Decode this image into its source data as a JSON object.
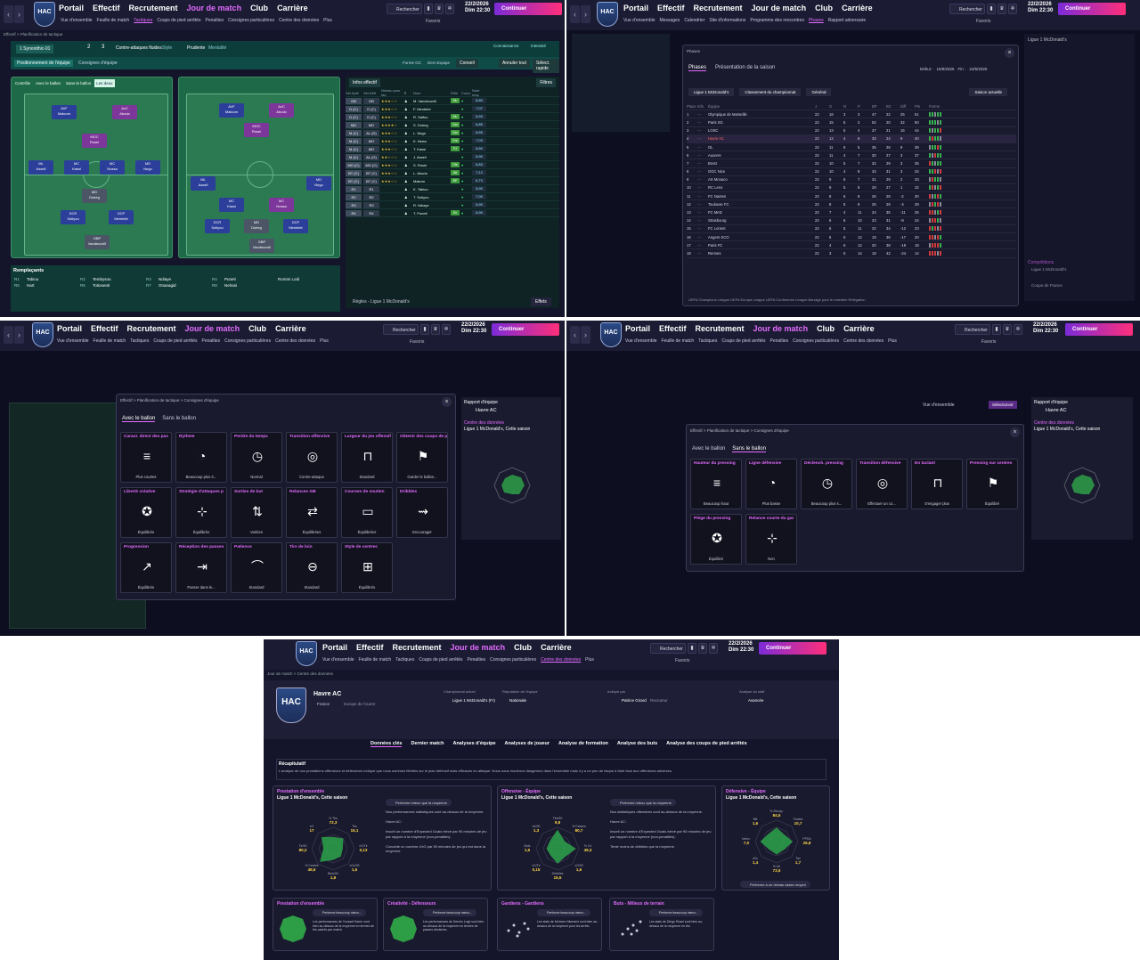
{
  "nav": {
    "portail": "Portail",
    "effectif": "Effectif",
    "recrutement": "Recrutement",
    "jour_de_match": "Jour de match",
    "club": "Club",
    "carriere": "Carrière",
    "search": "Rechercher",
    "date": "22/2/2026",
    "day_time": "Dim 22:30",
    "continuer": "Continuer",
    "favoris": "Favoris",
    "plus": "Plus"
  },
  "club": {
    "logo_text": "HAC"
  },
  "sub_jdm": [
    "Vue d'ensemble",
    "Feuille de match",
    "Tactiques",
    "Coups de pied arrêtés",
    "Penalties",
    "Consignes particulières",
    "Centre des données"
  ],
  "sub_jdm_short": [
    "Vue d'ensemble",
    "Messages",
    "Calendrier",
    "Site d'informations",
    "Programme des rencontres",
    "Phases",
    "Rapport adversaire"
  ],
  "breadcrumb_tactics": "Effectif  >  Planification de tactique",
  "tactics": {
    "slot": "1  Synonithic-01",
    "slots": [
      "2",
      "3"
    ],
    "style": "Contre-attaques fluides",
    "style_tag": "Style",
    "mentalite": "Prudente",
    "mentalite_tag": "Mentalité",
    "familiarity": "Connaissance",
    "intensity": "Intensité",
    "tab1": "Positionnement de l'équipe",
    "tab2": "Consignes d'équipe",
    "form": "Forme GC",
    "xg": "Dern.Equipe",
    "conseil": "Conseil",
    "annuler": "Annuler tout",
    "select_rapide": "Sélect. rapide",
    "phases": [
      "Contrôle",
      "Avec le ballon",
      "Sans le ballon",
      "Les deux"
    ],
    "infos": "Infos effectif",
    "filtres": "Filtres",
    "col_headers": [
      "Sél.Actif",
      "Sél.Défi",
      "Niveau pour tac.",
      "Ⅱ",
      "Nom",
      "Rôle",
      "Cond.",
      "Note moy."
    ],
    "rows": [
      {
        "pos": "GB",
        "role": "GB",
        "stars": "★★★☆☆",
        "name": "M. Vandecovill",
        "tag": "Mu",
        "val": "6,80"
      },
      {
        "pos": "D (C)",
        "role": "D (C)",
        "stars": "★★★☆☆",
        "name": "F. Mentelet",
        "tag": "",
        "val": "7,07"
      },
      {
        "pos": "D (C)",
        "role": "D (C)",
        "stars": "★★★☆☆",
        "name": "R. Saifou",
        "tag": "Mu",
        "val": "6,93"
      },
      {
        "pos": "MD",
        "role": "MD",
        "stars": "★★★★☆",
        "name": "S. Doireg",
        "tag": "Gar",
        "val": "6,85"
      },
      {
        "pos": "M (C)",
        "role": "AL (D)",
        "stars": "★★★☆☆",
        "name": "L. Nego",
        "tag": "Gar",
        "val": "6,55"
      },
      {
        "pos": "M (C)",
        "role": "MO",
        "stars": "★★★☆☆",
        "name": "K. Newo",
        "tag": "Ent",
        "val": "7,03"
      },
      {
        "pos": "M (C)",
        "role": "MO",
        "stars": "★★★☆☆",
        "name": "T. Kassi",
        "tag": "PJ",
        "val": "6,50"
      },
      {
        "pos": "M (C)",
        "role": "AL (G)",
        "stars": "★★☆☆☆",
        "name": "J. Assell",
        "tag": "",
        "val": "6,90"
      },
      {
        "pos": "MO (C)",
        "role": "MO (C)",
        "stars": "★★★☆☆",
        "name": "S. Rosel",
        "tag": "Ofe",
        "val": "6,83"
      },
      {
        "pos": "BT (C)",
        "role": "BT (C)",
        "stars": "★★★☆☆",
        "name": "L. Abodo",
        "tag": "Att",
        "val": "7,12"
      },
      {
        "pos": "BT (C)",
        "role": "BT (C)",
        "stars": "★★★☆☆",
        "name": "Makom",
        "tag": "BP",
        "val": "6,73"
      },
      {
        "pos": "R1",
        "role": "R1",
        "stars": "",
        "name": "K. Tabiou",
        "tag": "",
        "val": "6,90"
      },
      {
        "pos": "R2",
        "role": "R2",
        "stars": "",
        "name": "T. Sotiyou",
        "tag": "",
        "val": "7,00"
      },
      {
        "pos": "R3",
        "role": "R3",
        "stars": "",
        "name": "R. Ndiaye",
        "tag": "",
        "val": "6,90"
      },
      {
        "pos": "R4",
        "role": "R4",
        "stars": "",
        "name": "T. Puneti",
        "tag": "Ex",
        "val": "6,90"
      }
    ],
    "rules": "Règles - Ligue 1 McDonald's",
    "next": "Effets",
    "remplacants": "Remplaçants",
    "bench": [
      {
        "pos": "R1",
        "name": "Tabiou",
        "pos2": "R2",
        "name2": "Tembysou",
        "pos3": "R3",
        "name3": "Ndiaye",
        "pos4": "R4",
        "name4": "Puneti",
        "name5": "Rommi Lodi"
      },
      {
        "pos": "R5",
        "name": "Hart",
        "pos2": "R6",
        "name2": "Totionenti",
        "pos3": "R7",
        "name3": "Onanagid",
        "pos4": "R8",
        "name4": "Nehasi",
        "name5": ""
      }
    ],
    "players_left": [
      {
        "name": "Matcom",
        "role": "AVF"
      },
      {
        "name": "Abodo",
        "role": "AvC"
      },
      {
        "name": "Rosel",
        "role": "MOC"
      },
      {
        "name": "Assell",
        "role": "ML"
      },
      {
        "name": "Kassi",
        "role": "MC"
      },
      {
        "name": "Nossa",
        "role": "MC"
      },
      {
        "name": "Nego",
        "role": "MD"
      },
      {
        "name": "Doireg",
        "role": "MD"
      },
      {
        "name": "Sotiyou",
        "role": "DCR"
      },
      {
        "name": "Mentelet",
        "role": "DCP"
      },
      {
        "name": "Vandecovill",
        "role": "GBP"
      }
    ]
  },
  "league": {
    "title": "Phases",
    "tab1": "Phases",
    "tab2": "Présentation de la saison",
    "debut": "Début :",
    "debut_val": "15/8/2025",
    "fin": "Fin :",
    "fin_val": "24/5/2026",
    "filter1": "Ligue 1 McDonald's",
    "filter2": "Classement du championnat",
    "filter3": "Général",
    "saison": "Saison actuelle",
    "headers": [
      "Place",
      "Info",
      "Équipe",
      "J",
      "G",
      "N",
      "P",
      "BP",
      "BC",
      "Diff",
      "Pts",
      "Forme"
    ],
    "rows": [
      {
        "p": "1",
        "t": "Olympique de Marseille",
        "j": "22",
        "g": "16",
        "n": "3",
        "d": "3",
        "bp": "47",
        "bc": "22",
        "diff": "25",
        "pts": "51"
      },
      {
        "p": "2",
        "t": "Paris SG",
        "j": "22",
        "g": "15",
        "n": "5",
        "d": "2",
        "bp": "52",
        "bc": "20",
        "diff": "32",
        "pts": "50"
      },
      {
        "p": "3",
        "t": "LOSC",
        "j": "22",
        "g": "13",
        "n": "5",
        "d": "4",
        "bp": "37",
        "bc": "21",
        "diff": "16",
        "pts": "44"
      },
      {
        "p": "4",
        "t": "Havre AC",
        "j": "22",
        "g": "12",
        "n": "4",
        "d": "6",
        "bp": "33",
        "bc": "24",
        "diff": "9",
        "pts": "40"
      },
      {
        "p": "5",
        "t": "OL",
        "j": "22",
        "g": "11",
        "n": "6",
        "d": "5",
        "bp": "35",
        "bc": "26",
        "diff": "9",
        "pts": "39"
      },
      {
        "p": "6",
        "t": "Auxerre",
        "j": "22",
        "g": "11",
        "n": "4",
        "d": "7",
        "bp": "30",
        "bc": "27",
        "diff": "3",
        "pts": "37"
      },
      {
        "p": "7",
        "t": "Brest",
        "j": "22",
        "g": "10",
        "n": "5",
        "d": "7",
        "bp": "32",
        "bc": "29",
        "diff": "3",
        "pts": "35"
      },
      {
        "p": "8",
        "t": "OGC Nice",
        "j": "22",
        "g": "10",
        "n": "4",
        "d": "8",
        "bp": "34",
        "bc": "31",
        "diff": "3",
        "pts": "34"
      },
      {
        "p": "9",
        "t": "AS Monaco",
        "j": "22",
        "g": "9",
        "n": "6",
        "d": "7",
        "bp": "31",
        "bc": "29",
        "diff": "2",
        "pts": "33"
      },
      {
        "p": "10",
        "t": "RC Lens",
        "j": "22",
        "g": "9",
        "n": "5",
        "d": "8",
        "bp": "28",
        "bc": "27",
        "diff": "1",
        "pts": "32"
      },
      {
        "p": "11",
        "t": "FC Nantes",
        "j": "22",
        "g": "8",
        "n": "6",
        "d": "8",
        "bp": "26",
        "bc": "28",
        "diff": "-2",
        "pts": "30"
      },
      {
        "p": "12",
        "t": "Toulouse FC",
        "j": "22",
        "g": "8",
        "n": "5",
        "d": "9",
        "bp": "25",
        "bc": "29",
        "diff": "-4",
        "pts": "29"
      },
      {
        "p": "13",
        "t": "FC Metz",
        "j": "22",
        "g": "7",
        "n": "4",
        "d": "11",
        "bp": "24",
        "bc": "35",
        "diff": "-11",
        "pts": "25"
      },
      {
        "p": "14",
        "t": "Strasbourg",
        "j": "22",
        "g": "6",
        "n": "6",
        "d": "10",
        "bp": "23",
        "bc": "31",
        "diff": "-8",
        "pts": "24"
      },
      {
        "p": "15",
        "t": "FC Lorient",
        "j": "22",
        "g": "6",
        "n": "5",
        "d": "11",
        "bp": "22",
        "bc": "34",
        "diff": "-12",
        "pts": "23"
      },
      {
        "p": "16",
        "t": "Angers SCO",
        "j": "22",
        "g": "5",
        "n": "5",
        "d": "12",
        "bp": "19",
        "bc": "36",
        "diff": "-17",
        "pts": "20"
      },
      {
        "p": "17",
        "t": "Paris FC",
        "j": "22",
        "g": "4",
        "n": "6",
        "d": "12",
        "bp": "20",
        "bc": "38",
        "diff": "-18",
        "pts": "18"
      },
      {
        "p": "18",
        "t": "Rennes",
        "j": "22",
        "g": "3",
        "n": "5",
        "d": "14",
        "bp": "18",
        "bc": "42",
        "diff": "-24",
        "pts": "14"
      }
    ],
    "legend": "UEFA Champions League    UEFA Europa League    UEFA Conference League    Barrage pour le maintien    Relégation",
    "side_title": "Ligue 1 McDonald's",
    "side_comp": "Compétitions",
    "side_comp1": "Ligue 1 McDonald's",
    "side_comp2": "Coupe de France"
  },
  "with_ball": {
    "tab_a": "Avec le ballon",
    "tab_b": "Sans le ballon",
    "cards": [
      {
        "t": "Caract. direct des pas",
        "v": "Plus courtes"
      },
      {
        "t": "Rythme",
        "v": "Beaucoup plus é..."
      },
      {
        "t": "Perdre du temps",
        "v": "Normal"
      },
      {
        "t": "Transition offensive",
        "v": "Contre-attaque"
      },
      {
        "t": "Largeur du jeu offensif",
        "v": "Standard"
      },
      {
        "t": "Obtenir des coups de p",
        "v": "Garder le ballon..."
      },
      {
        "t": "Liberté créative",
        "v": "Équilibrée"
      },
      {
        "t": "Stratégie d'attaques p",
        "v": "Équilibrée"
      },
      {
        "t": "Sorties de but",
        "v": "Variées"
      },
      {
        "t": "Relances GB",
        "v": "Équilibrées"
      },
      {
        "t": "Courses de soutien",
        "v": "Équilibrées"
      },
      {
        "t": "Dribbles",
        "v": "Encourager"
      },
      {
        "t": "Progression",
        "v": "Équilibrée"
      },
      {
        "t": "Réception des passes",
        "v": "Passer dans le..."
      },
      {
        "t": "Patience",
        "v": "Standard"
      },
      {
        "t": "Tirs de loin",
        "v": "Standard"
      },
      {
        "t": "Style de centres",
        "v": "Équilibrés"
      }
    ],
    "side_rapport": "Rapport d'équipe",
    "side_team": "Havre AC",
    "side_data": "Centre des données",
    "side_league": "Ligue 1 McDonald's, Cette saison",
    "breadcrumb": "Effectif > Planification de tactique > Consignes d'équipe"
  },
  "without_ball": {
    "tab_a": "Avec le ballon",
    "tab_b": "Sans le ballon",
    "cards": [
      {
        "t": "Hauteur du pressing",
        "v": "Beaucoup haut"
      },
      {
        "t": "Ligne défensive",
        "v": "Plus basse"
      },
      {
        "t": "Déclench. pressing",
        "v": "Beaucoup plus s..."
      },
      {
        "t": "Transition défensive",
        "v": "Effectuer un co..."
      },
      {
        "t": "En taclant",
        "v": "S'engager plus"
      },
      {
        "t": "Pressing sur centres",
        "v": "Équilibré"
      },
      {
        "t": "Piège du pressing",
        "v": "Équilibré"
      },
      {
        "t": "Relance courte du gar",
        "v": "Non"
      }
    ],
    "overview": "Vue d'ensemble",
    "selection": "Sélectionné"
  },
  "data_centre": {
    "breadcrumb": "Jour de match  >  Centre des données",
    "team": "Havre AC",
    "country": "France",
    "region": "Europe de l'ouest",
    "champ_label": "Championnat actuel",
    "champ": "Ligue 1 McDonald's (Fr)",
    "rep_label": "Réputation de l'équipe",
    "rep": "Nationale",
    "analyst_label": "Indiqué par",
    "analyst": "Patrice Girard",
    "analyst_role": "Recruteur",
    "data_label": "Analyse du staff",
    "data_val": "Avancée",
    "tabs": [
      "Données clés",
      "Dernier match",
      "Analyses d'équipe",
      "Analyses de joueur",
      "Analyse de formation",
      "Analyse des buts",
      "Analyse des coups de pied arrêtés"
    ],
    "recap_title": "Récapitulatif",
    "recap_text": "L'analyse de nos prestations offensives et défensives indique que nous sommes fébriles sur le plan défensif mais efficaces en attaque. Nous nous montrons dangereux dans l'ensemble mais il y a un peu de risque à faire face aux offensives adverses.",
    "card1_t": "Prestation d'ensemble",
    "card1_s": "Ligue 1 McDonald's, Cette saison",
    "card1_pill": "Performe mieux que la moyenne",
    "card1_text": "Nos performances statistiques sont au-dessus de la moyenne.\n\nHavre AC :\n\nInscrit un nombre d'Expected Goals élevé par 90 minutes de jeu par rapport à la moyenne (non-penalties).\n\nConcède un nombre d'xG par 90 minutes de jeu qui est dans la moyenne.",
    "card2_t": "Offensive - Équipe",
    "card2_s": "Ligue 1 McDonald's, Cette saison",
    "card2_pill": "Performe mieux que la moyenne",
    "card2_text": "Nos statistiques offensives sont au-dessus de la moyenne.\n\nHavre AC :\n\nInscrit un nombre d'Expected Goals élevé par 90 minutes de jeu par rapport à la moyenne (non-penalties).\n\nTente moins de dribbles que la moyenne.",
    "card3_t": "Défensive - Équipe",
    "card3_s": "Ligue 1 McDonald's, Cette saison",
    "card3_pill": "Performe à un niveau assez moyen",
    "radar1": [
      {
        "l": "% Tirs",
        "v": "72,3"
      },
      {
        "l": "Tirs",
        "v": "15,1"
      },
      {
        "l": "xG/Tir",
        "v": "0,13"
      },
      {
        "l": "xGc/90",
        "v": "1,5"
      },
      {
        "l": "Buts/90",
        "v": "1,8"
      },
      {
        "l": "% Cadrés",
        "v": "49,5"
      },
      {
        "l": "Tir/90",
        "v": "80,2"
      },
      {
        "l": "xG",
        "v": "17"
      }
    ],
    "radar2": [
      {
        "l": "Tirs/90",
        "v": "9,8"
      },
      {
        "l": "% Passes",
        "v": "80,7"
      },
      {
        "l": "% Ce",
        "v": "49,3"
      },
      {
        "l": "xG/90",
        "v": "1,6"
      },
      {
        "l": "Dribbles",
        "v": "15,5"
      },
      {
        "l": "xG/Tir",
        "v": "0,15"
      },
      {
        "l": "Buts",
        "v": "1,5"
      },
      {
        "l": "xA/90",
        "v": "1,3"
      }
    ],
    "radar3": [
      {
        "l": "% Recup.",
        "v": "84,5"
      },
      {
        "l": "Fautes",
        "v": "10,7"
      },
      {
        "l": "PPDA",
        "v": "26,8"
      },
      {
        "l": "Tac",
        "v": "1,7"
      },
      {
        "l": "% Air",
        "v": "73,5"
      },
      {
        "l": "xGc",
        "v": "1,4"
      },
      {
        "l": "Interc.",
        "v": "7,0"
      },
      {
        "l": "Blk",
        "v": "1,6"
      }
    ],
    "mini": [
      {
        "t": "Prestation d'ensemble",
        "pill": "Performe beaucoup mieux..."
      },
      {
        "t": "Créativité - Défenseurs",
        "pill": "Performe beaucoup mieux..."
      },
      {
        "t": "Gardiens - Gardiens",
        "pill": "Performe beaucoup mieux..."
      },
      {
        "t": "Buts - Milieux de terrain",
        "pill": "Performe beaucoup mieux..."
      }
    ],
    "mini_text1": "Les performances de Youssef Karim sont bien au-dessus de la moyenne en termes de tirs cadrés par match.",
    "mini_text2": "Les performances de Dennis Luigi sont bien au-dessus de la moyenne en termes de passes décisives.",
    "mini_text3": "Les stats de Mohcen Nkemeni sont bien au-dessus de la moyenne pour les arrêts.",
    "mini_text4": "Les stats de Diego Rosel sont bien au-dessus de la moyenne en tirs."
  }
}
